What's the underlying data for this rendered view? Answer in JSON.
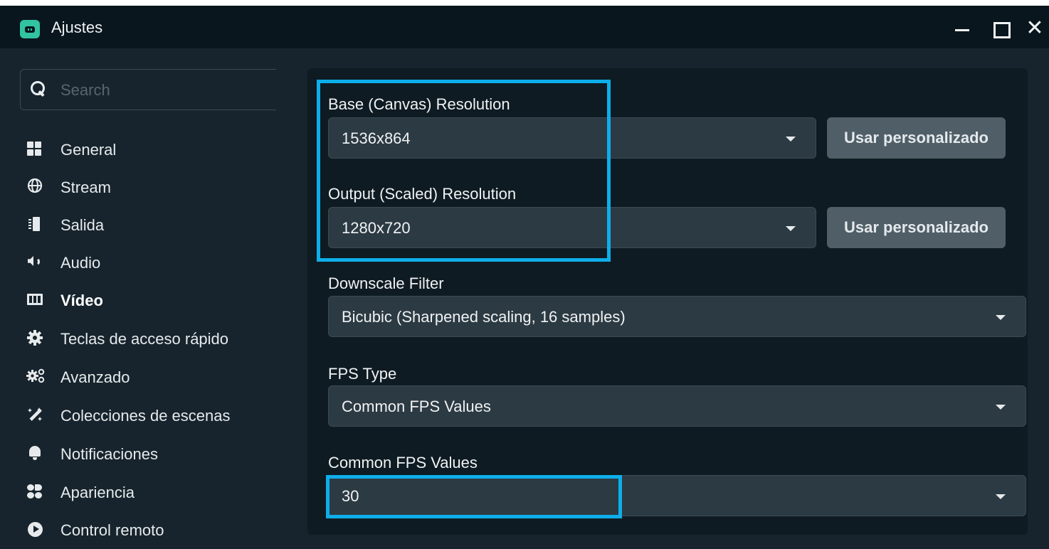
{
  "window": {
    "title": "Ajustes",
    "logo_icon": "streamlabs-logo-icon",
    "controls": {
      "minimize_icon": "minimize-icon",
      "maximize_icon": "maximize-icon",
      "close_glyph": "✕"
    }
  },
  "search": {
    "placeholder": "Search",
    "value": ""
  },
  "sidebar": {
    "items": [
      {
        "label": "General",
        "icon": "grid-icon"
      },
      {
        "label": "Stream",
        "icon": "globe-icon"
      },
      {
        "label": "Salida",
        "icon": "output-icon"
      },
      {
        "label": "Audio",
        "icon": "speaker-icon"
      },
      {
        "label": "Vídeo",
        "icon": "film-icon",
        "active": true
      },
      {
        "label": "Teclas de acceso rápido",
        "icon": "gear-icon"
      },
      {
        "label": "Avanzado",
        "icon": "gears-icon"
      },
      {
        "label": "Colecciones de escenas",
        "icon": "magic-wand-icon"
      },
      {
        "label": "Notificaciones",
        "icon": "bell-icon"
      },
      {
        "label": "Apariencia",
        "icon": "appearance-icon"
      },
      {
        "label": "Control remoto",
        "icon": "play-circle-icon"
      }
    ]
  },
  "video": {
    "base_resolution": {
      "label": "Base (Canvas) Resolution",
      "value": "1536x864",
      "custom_button": "Usar personalizado"
    },
    "output_resolution": {
      "label": "Output (Scaled) Resolution",
      "value": "1280x720",
      "custom_button": "Usar personalizado"
    },
    "downscale_filter": {
      "label": "Downscale Filter",
      "value": "Bicubic (Sharpened scaling, 16 samples)"
    },
    "fps_type": {
      "label": "FPS Type",
      "value": "Common FPS Values"
    },
    "common_fps": {
      "label": "Common FPS Values",
      "value": "30"
    }
  },
  "colors": {
    "window_bg": "#17242d",
    "titlebar_bg": "#09161d",
    "panel_bg": "#0e1b22",
    "select_bg": "#2c3a43",
    "button_bg": "#4f5e67",
    "highlight": "#0eaeea",
    "logo": "#31c3a2"
  }
}
